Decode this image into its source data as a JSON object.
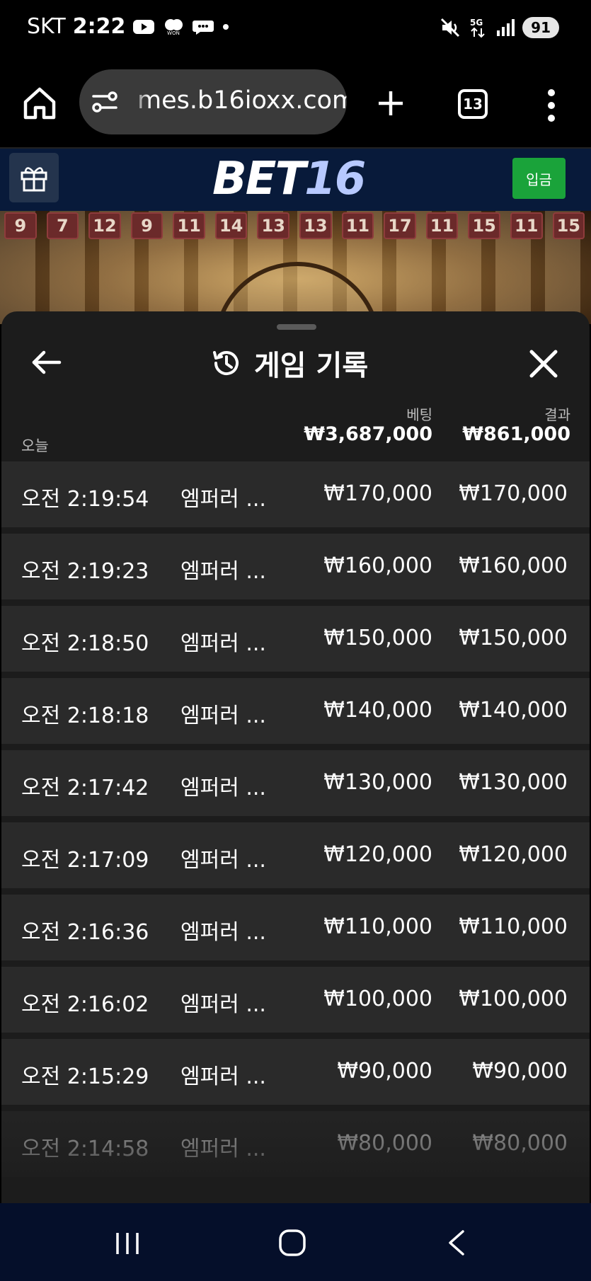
{
  "status_bar": {
    "carrier": "SKT",
    "time": "2:22",
    "battery": "91"
  },
  "browser": {
    "url": "mes.b16ioxx.com",
    "tab_count": "13"
  },
  "site": {
    "logo_text": "BET",
    "logo_num": "16",
    "deposit_label": "입금",
    "recent_results": [
      "9",
      "7",
      "12",
      "9",
      "11",
      "14",
      "13",
      "13",
      "11",
      "17",
      "11",
      "15",
      "11",
      "15"
    ]
  },
  "sheet": {
    "title": "게임 기록",
    "summary": {
      "today_label": "오늘",
      "bet_label": "베팅",
      "bet_total": "₩3,687,000",
      "result_label": "결과",
      "result_total": "₩861,000"
    },
    "rows": [
      {
        "time": "오전 2:19:54",
        "game": "엠퍼러 ...",
        "bet": "₩170,000",
        "result": "₩170,000"
      },
      {
        "time": "오전 2:19:23",
        "game": "엠퍼러 ...",
        "bet": "₩160,000",
        "result": "₩160,000"
      },
      {
        "time": "오전 2:18:50",
        "game": "엠퍼러 ...",
        "bet": "₩150,000",
        "result": "₩150,000"
      },
      {
        "time": "오전 2:18:18",
        "game": "엠퍼러 ...",
        "bet": "₩140,000",
        "result": "₩140,000"
      },
      {
        "time": "오전 2:17:42",
        "game": "엠퍼러 ...",
        "bet": "₩130,000",
        "result": "₩130,000"
      },
      {
        "time": "오전 2:17:09",
        "game": "엠퍼러 ...",
        "bet": "₩120,000",
        "result": "₩120,000"
      },
      {
        "time": "오전 2:16:36",
        "game": "엠퍼러 ...",
        "bet": "₩110,000",
        "result": "₩110,000"
      },
      {
        "time": "오전 2:16:02",
        "game": "엠퍼러 ...",
        "bet": "₩100,000",
        "result": "₩100,000"
      },
      {
        "time": "오전 2:15:29",
        "game": "엠퍼러 ...",
        "bet": "₩90,000",
        "result": "₩90,000"
      },
      {
        "time": "오전 2:14:58",
        "game": "엠퍼러 ...",
        "bet": "₩80,000",
        "result": "₩80,000"
      }
    ]
  },
  "icons": {
    "home": "home-icon",
    "settings": "site-settings-icon",
    "add_tab": "plus-icon",
    "menu": "more-vert-icon",
    "gift": "gift-icon",
    "back": "arrow-left-icon",
    "history": "history-icon",
    "close": "close-icon"
  },
  "colors": {
    "header_bg": "#081a3a",
    "deposit_green": "#1aa33a",
    "sheet_bg": "#1c1c1c",
    "row_bg": "#2a2a2a",
    "logo_accent": "#b7c9ff"
  }
}
